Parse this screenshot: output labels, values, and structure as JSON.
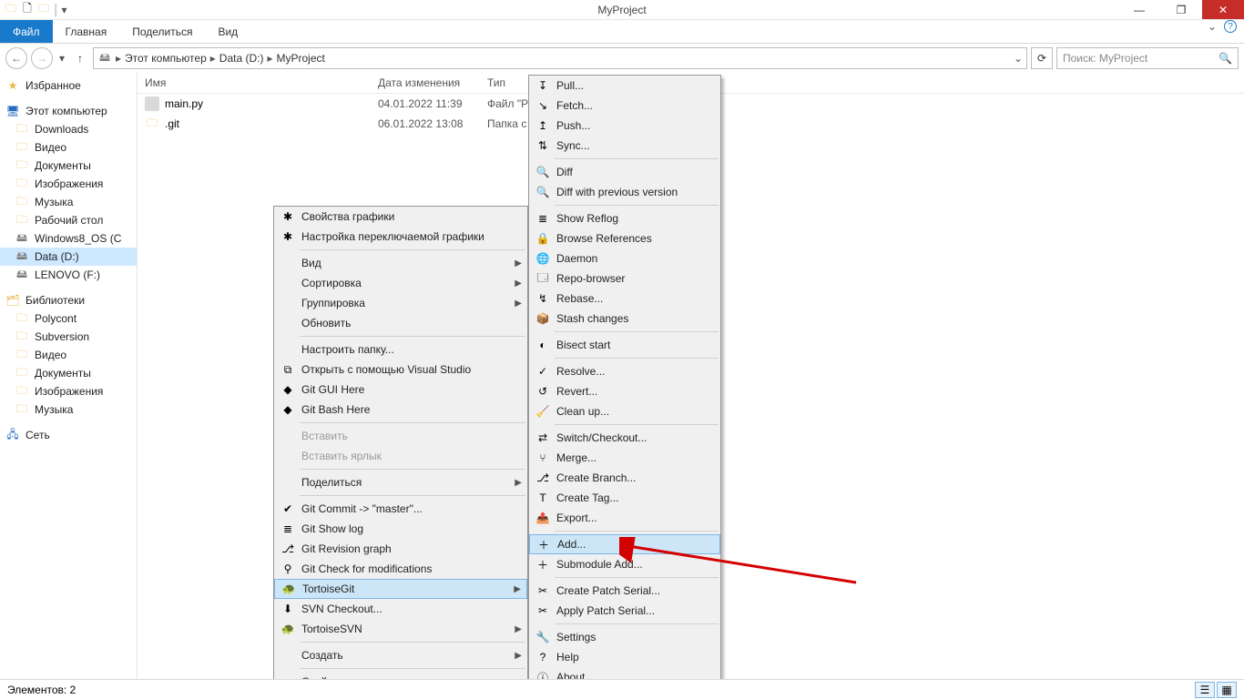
{
  "window": {
    "title": "MyProject"
  },
  "ribbon": {
    "file": "Файл",
    "tabs": [
      "Главная",
      "Поделиться",
      "Вид"
    ]
  },
  "breadcrumbs": [
    "Этот компьютер",
    "Data (D:)",
    "MyProject"
  ],
  "search_placeholder": "Поиск: MyProject",
  "columns": {
    "name": "Имя",
    "date": "Дата изменения",
    "type": "Тип"
  },
  "files": [
    {
      "name": "main.py",
      "date": "04.01.2022 11:39",
      "type": "Файл \"P"
    },
    {
      "name": ".git",
      "date": "06.01.2022 13:08",
      "type": "Папка с"
    }
  ],
  "sidebar": {
    "favorites": "Избранное",
    "computer": "Этот компьютер",
    "comp_items": [
      "Downloads",
      "Видео",
      "Документы",
      "Изображения",
      "Музыка",
      "Рабочий стол",
      "Windows8_OS (C",
      "Data (D:)",
      "LENOVO (F:)"
    ],
    "libraries": "Библиотеки",
    "lib_items": [
      "Polycont",
      "Subversion",
      "Видео",
      "Документы",
      "Изображения",
      "Музыка"
    ],
    "network": "Сеть"
  },
  "ctx1": {
    "items": [
      {
        "label": "Свойства графики",
        "ico": "✱"
      },
      {
        "label": "Настройка переключаемой графики",
        "ico": "✱"
      },
      {
        "sep": true
      },
      {
        "label": "Вид",
        "sub": true
      },
      {
        "label": "Сортировка",
        "sub": true
      },
      {
        "label": "Группировка",
        "sub": true
      },
      {
        "label": "Обновить"
      },
      {
        "sep": true
      },
      {
        "label": "Настроить папку..."
      },
      {
        "label": "Открыть с помощью Visual Studio",
        "ico": "⧉"
      },
      {
        "label": "Git GUI Here",
        "ico": "◆"
      },
      {
        "label": "Git Bash Here",
        "ico": "◆"
      },
      {
        "sep": true
      },
      {
        "label": "Вставить",
        "disabled": true
      },
      {
        "label": "Вставить ярлык",
        "disabled": true
      },
      {
        "sep": true
      },
      {
        "label": "Поделиться",
        "sub": true
      },
      {
        "sep": true
      },
      {
        "label": "Git Commit -> \"master\"...",
        "ico": "✔"
      },
      {
        "label": "Git Show log",
        "ico": "≣"
      },
      {
        "label": "Git Revision graph",
        "ico": "⎇"
      },
      {
        "label": "Git Check for modifications",
        "ico": "⚲"
      },
      {
        "label": "TortoiseGit",
        "ico": "🐢",
        "sub": true,
        "selected": true
      },
      {
        "label": "SVN Checkout...",
        "ico": "⬇"
      },
      {
        "label": "TortoiseSVN",
        "ico": "🐢",
        "sub": true
      },
      {
        "sep": true
      },
      {
        "label": "Создать",
        "sub": true
      },
      {
        "sep": true
      },
      {
        "label": "Свойства"
      }
    ]
  },
  "ctx2": {
    "items": [
      {
        "label": "Pull...",
        "ico": "↧"
      },
      {
        "label": "Fetch...",
        "ico": "↘"
      },
      {
        "label": "Push...",
        "ico": "↥"
      },
      {
        "label": "Sync...",
        "ico": "⇅"
      },
      {
        "sep": true
      },
      {
        "label": "Diff",
        "ico": "🔍"
      },
      {
        "label": "Diff with previous version",
        "ico": "🔍"
      },
      {
        "sep": true
      },
      {
        "label": "Show Reflog",
        "ico": "≣"
      },
      {
        "label": "Browse References",
        "ico": "🔒"
      },
      {
        "label": "Daemon",
        "ico": "🌐"
      },
      {
        "label": "Repo-browser",
        "ico": "🗔"
      },
      {
        "label": "Rebase...",
        "ico": "↯"
      },
      {
        "label": "Stash changes",
        "ico": "📦"
      },
      {
        "sep": true
      },
      {
        "label": "Bisect start",
        "ico": "◐"
      },
      {
        "sep": true
      },
      {
        "label": "Resolve...",
        "ico": "✓"
      },
      {
        "label": "Revert...",
        "ico": "↺"
      },
      {
        "label": "Clean up...",
        "ico": "🧹"
      },
      {
        "sep": true
      },
      {
        "label": "Switch/Checkout...",
        "ico": "⇄"
      },
      {
        "label": "Merge...",
        "ico": "⑂"
      },
      {
        "label": "Create Branch...",
        "ico": "⎇"
      },
      {
        "label": "Create Tag...",
        "ico": "T"
      },
      {
        "label": "Export...",
        "ico": "📤"
      },
      {
        "sep": true
      },
      {
        "label": "Add...",
        "ico": "＋",
        "selected": true
      },
      {
        "label": "Submodule Add...",
        "ico": "＋"
      },
      {
        "sep": true
      },
      {
        "label": "Create Patch Serial...",
        "ico": "✂"
      },
      {
        "label": "Apply Patch Serial...",
        "ico": "✂"
      },
      {
        "sep": true
      },
      {
        "label": "Settings",
        "ico": "🔧"
      },
      {
        "label": "Help",
        "ico": "?"
      },
      {
        "label": "About",
        "ico": "ⓘ"
      }
    ]
  },
  "status": {
    "items": "Элементов: 2"
  }
}
